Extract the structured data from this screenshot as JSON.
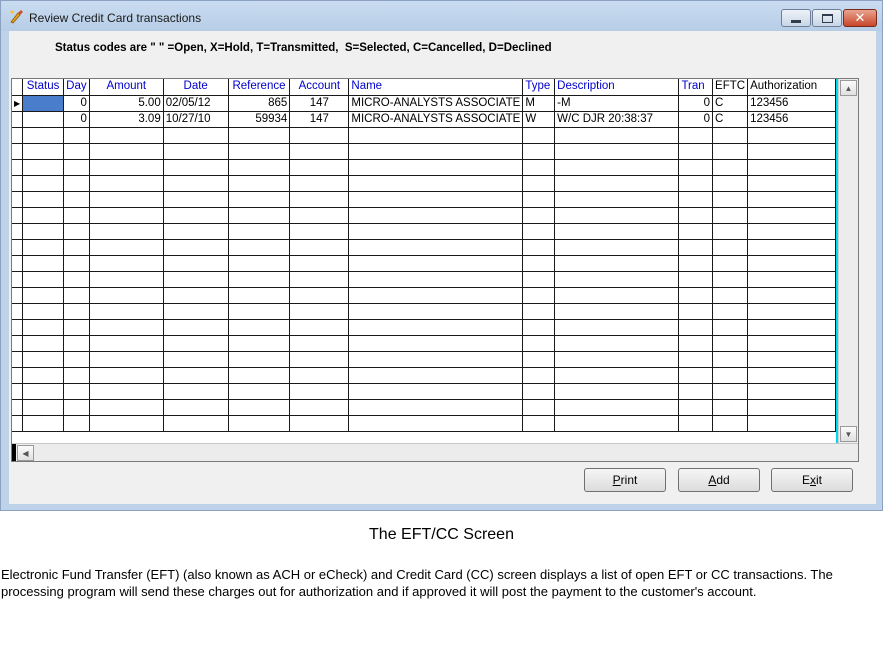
{
  "window": {
    "title": "Review Credit Card transactions",
    "minimize_icon": "minimize-icon",
    "maximize_icon": "maximize-icon",
    "close_icon": "close-icon"
  },
  "status_codes": "Status codes are \" \" =Open, X=Hold, T=Transmitted,  S=Selected, C=Cancelled, D=Declined",
  "grid": {
    "columns": [
      "Status",
      "Day",
      "Amount",
      "Date",
      "Reference",
      "Account",
      "Name",
      "Type",
      "Description",
      "Tran",
      "EFTC",
      "Authorization"
    ],
    "rows": [
      [
        "",
        "0",
        "5.00",
        "02/05/12",
        "865",
        "147",
        "MICRO-ANALYSTS ASSOCIATE",
        "M",
        "-M",
        "0",
        "C",
        "123456"
      ],
      [
        "",
        "0",
        "3.09",
        "10/27/10",
        "59934",
        "147",
        "MICRO-ANALYSTS ASSOCIATE",
        "W",
        "W/C DJR 20:38:37",
        "0",
        "C",
        "123456"
      ]
    ],
    "current_row_indicator": "row-pointer-icon",
    "accent_color": "#00d8f0"
  },
  "buttons": {
    "print": {
      "accel": "P",
      "rest": "rint"
    },
    "add": {
      "accel": "A",
      "rest": "dd"
    },
    "exit": {
      "pre": "E",
      "accel": "x",
      "rest": "it"
    }
  },
  "caption": "The EFT/CC Screen",
  "description": "Electronic Fund Transfer (EFT)  (also known as ACH or eCheck) and Credit Card (CC) screen displays a list of open EFT or CC transactions. The processing program will send these charges out for authorization and if approved it will post the payment to the customer's account."
}
